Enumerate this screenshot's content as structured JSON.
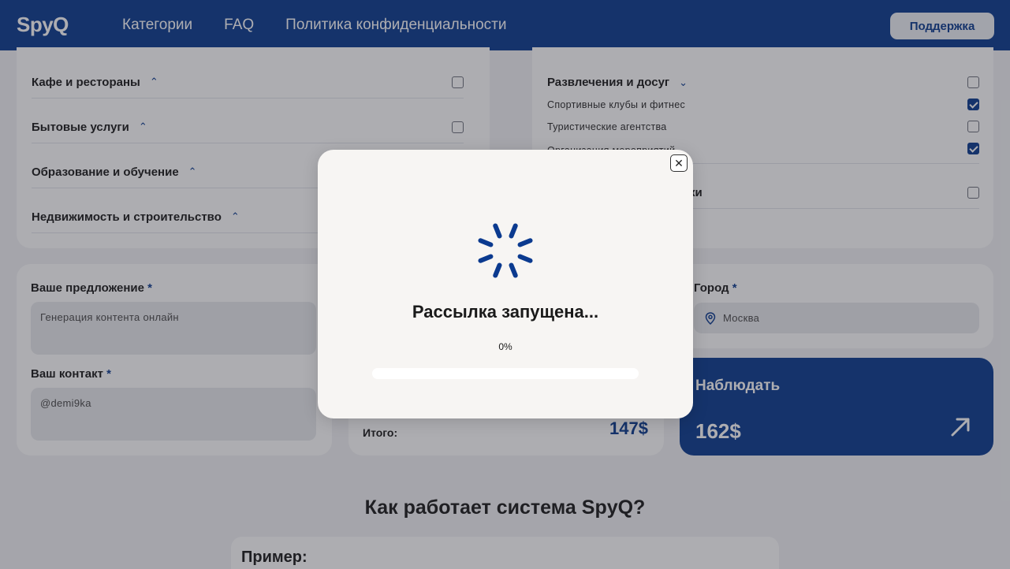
{
  "header": {
    "logo": "SpyQ",
    "nav": [
      "Категории",
      "FAQ",
      "Политика конфиденциальности"
    ],
    "support_label": "Поддержка"
  },
  "categories_left": [
    {
      "label": "Кафе и рестораны",
      "checked": false
    },
    {
      "label": "Бытовые услуги",
      "checked": false
    },
    {
      "label": "Образование и обучение",
      "checked": false
    },
    {
      "label": "Недвижимость и строительство",
      "checked": false
    }
  ],
  "categories_right": {
    "group": {
      "label": "Развлечения и досуг",
      "checked": false
    },
    "subitems": [
      {
        "label": "Спортивные клубы и фитнес",
        "checked": true
      },
      {
        "label": "Туристические агентства",
        "checked": false
      },
      {
        "label": "Организация мероприятий",
        "checked": true
      }
    ],
    "next_group_suffix": "ки"
  },
  "form": {
    "offer_label": "Ваше предложение",
    "offer_value": "Генерация контента онлайн",
    "contact_label": "Ваш контакт",
    "contact_value": "@demi9ka",
    "city_label": "Город",
    "city_value": "Москва",
    "required_mark": "*"
  },
  "total": {
    "label": "Итого:",
    "value": "147$"
  },
  "watch": {
    "title": "Наблюдать",
    "price": "162$"
  },
  "how_it_works": {
    "title": "Как работает система SpyQ?",
    "example_title": "Пример:"
  },
  "modal": {
    "title": "Рассылка запущена...",
    "progress_text": "0%",
    "progress": 0,
    "close_symbol": "✕"
  },
  "colors": {
    "brand": "#0b3a8f"
  }
}
